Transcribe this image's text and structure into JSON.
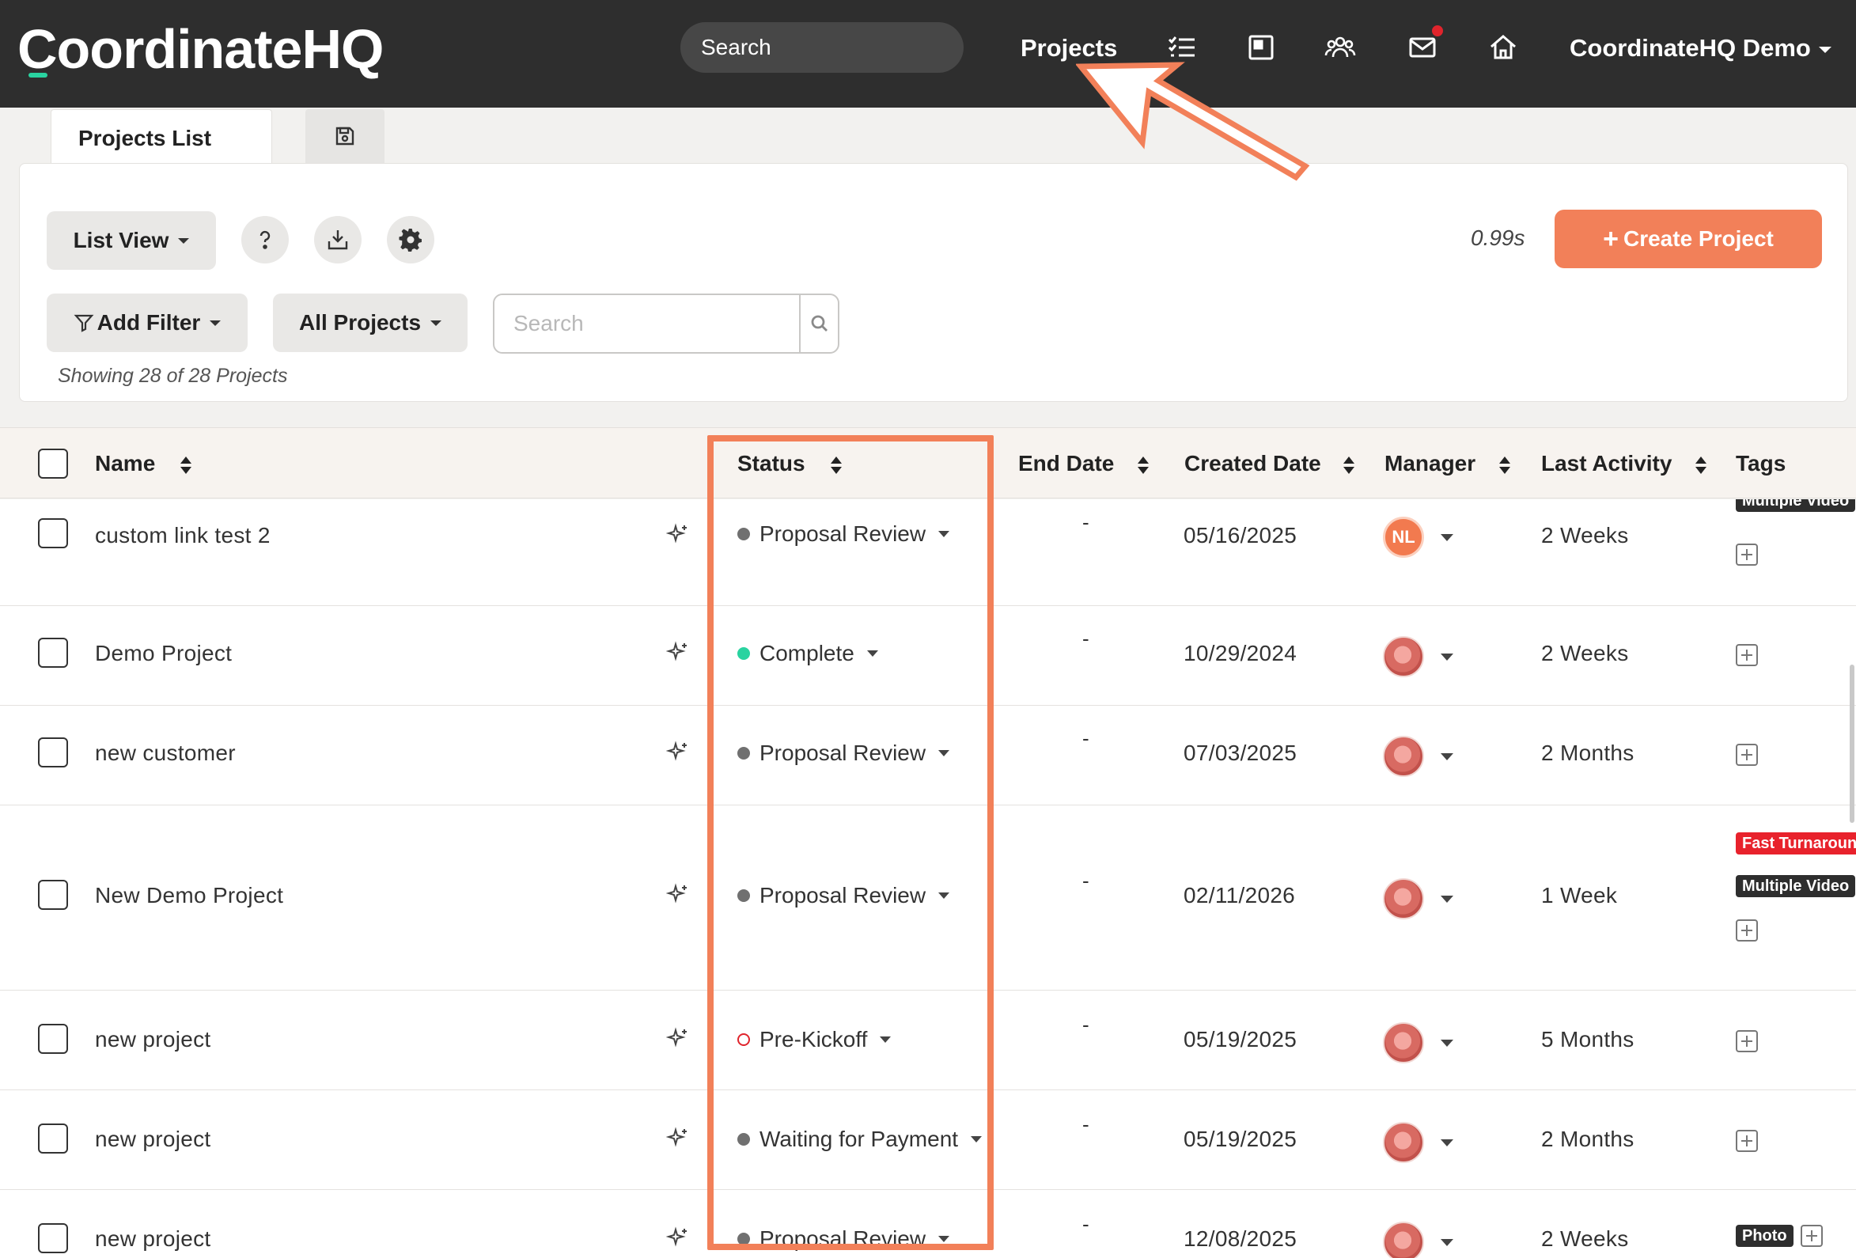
{
  "nav": {
    "logo": "CoordinateHQ",
    "search_placeholder": "Search",
    "projects_label": "Projects",
    "account_label": "CoordinateHQ Demo",
    "icons": [
      "tasks-icon",
      "board-icon",
      "team-icon",
      "mail-icon",
      "home-icon"
    ],
    "notification_color": "#e0242c"
  },
  "tabs": {
    "active_label": "Projects List",
    "secondary_icon": "save-icon"
  },
  "toolbar": {
    "list_view_label": "List View",
    "add_filter_label": "Add Filter",
    "all_projects_label": "All Projects",
    "search_placeholder": "Search",
    "timing": "0.99s",
    "create_label": "Create Project",
    "showing_text": "Showing 28 of 28 Projects",
    "accent_color": "#f28059"
  },
  "table": {
    "headers": {
      "name": "Name",
      "status": "Status",
      "end_date": "End Date",
      "created_date": "Created Date",
      "manager": "Manager",
      "last_activity": "Last Activity",
      "tags": "Tags"
    },
    "rows": [
      {
        "name": "custom link test 2",
        "status": "Proposal Review",
        "status_color": "gray",
        "end_date": "-",
        "created_date": "05/16/2025",
        "manager": "NL",
        "last_activity": "2 Weeks",
        "tags": [
          "Multiple Video"
        ]
      },
      {
        "name": "Demo Project",
        "status": "Complete",
        "status_color": "green",
        "end_date": "-",
        "created_date": "10/29/2024",
        "manager": "",
        "last_activity": "2 Weeks",
        "tags": []
      },
      {
        "name": "new customer",
        "status": "Proposal Review",
        "status_color": "gray",
        "end_date": "-",
        "created_date": "07/03/2025",
        "manager": "",
        "last_activity": "2 Months",
        "tags": []
      },
      {
        "name": "New Demo Project",
        "status": "Proposal Review",
        "status_color": "gray",
        "end_date": "-",
        "created_date": "02/11/2026",
        "manager": "",
        "last_activity": "1 Week",
        "tags": [
          "Fast Turnaround",
          "Multiple Video"
        ]
      },
      {
        "name": "new project",
        "status": "Pre-Kickoff",
        "status_color": "ring",
        "end_date": "-",
        "created_date": "05/19/2025",
        "manager": "",
        "last_activity": "5 Months",
        "tags": []
      },
      {
        "name": "new project",
        "status": "Waiting for Payment",
        "status_color": "gray",
        "end_date": "-",
        "created_date": "05/19/2025",
        "manager": "",
        "last_activity": "2 Months",
        "tags": []
      },
      {
        "name": "new project",
        "status": "Proposal Review",
        "status_color": "gray",
        "end_date": "-",
        "created_date": "12/08/2025",
        "manager": "",
        "last_activity": "2 Weeks",
        "tags": [
          "Photo"
        ]
      }
    ]
  }
}
